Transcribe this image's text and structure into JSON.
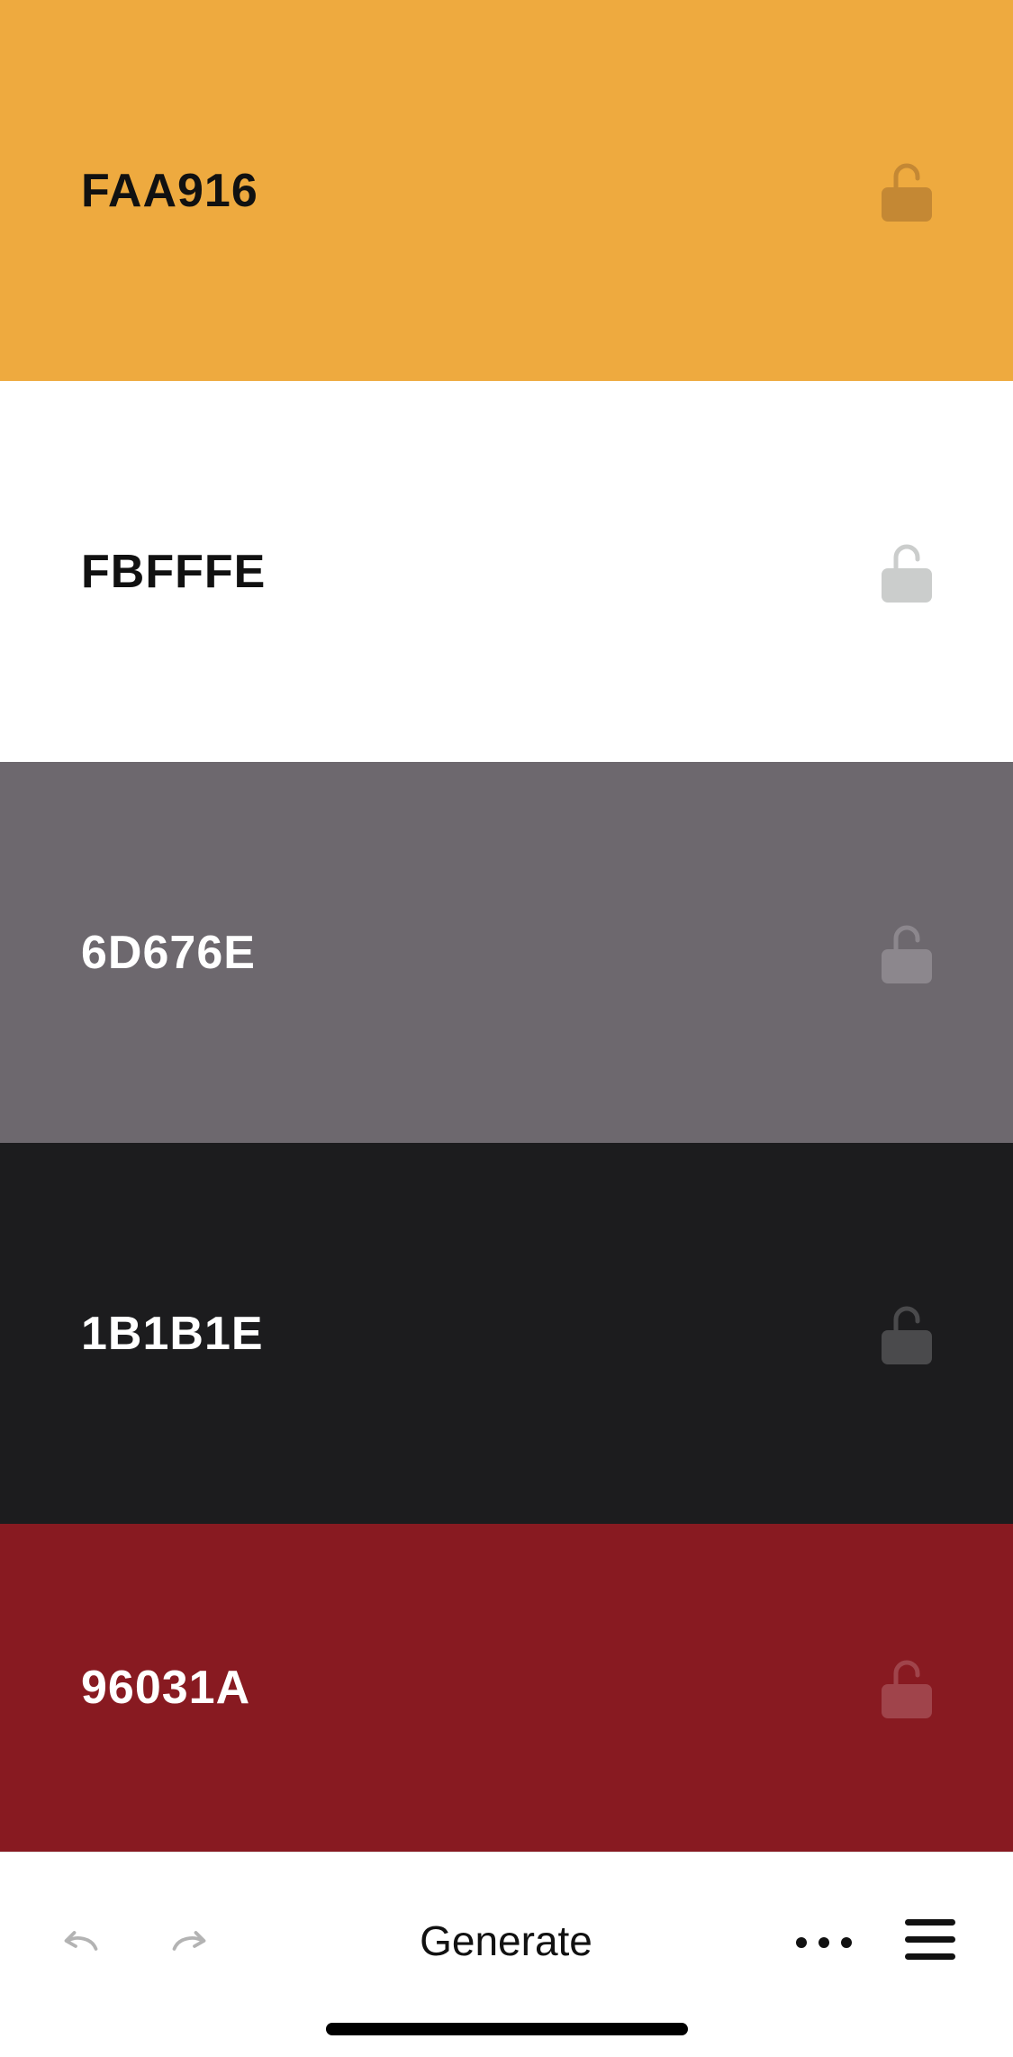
{
  "palette": {
    "swatches": [
      {
        "hex": "FAA916",
        "background": "#EEAA3F",
        "text_color": "#111111",
        "lock_color": "#C48834",
        "locked": false
      },
      {
        "hex": "FBFFFE",
        "background": "#FFFFFF",
        "text_color": "#111111",
        "lock_color": "#CBCDCC",
        "locked": false
      },
      {
        "hex": "6D676E",
        "background": "#6D686E",
        "text_color": "#FFFFFF",
        "lock_color": "#8C878D",
        "locked": false
      },
      {
        "hex": "1B1B1E",
        "background": "#1C1C1E",
        "text_color": "#FFFFFF",
        "lock_color": "#4A4A4C",
        "locked": false
      },
      {
        "hex": "96031A",
        "background": "#881A21",
        "text_color": "#FFFFFF",
        "lock_color": "#A0444B",
        "locked": false
      }
    ]
  },
  "toolbar": {
    "undo_icon": "undo-arrow-icon",
    "redo_icon": "redo-arrow-icon",
    "generate_label": "Generate",
    "more_icon": "more-dots-icon",
    "menu_icon": "hamburger-menu-icon",
    "disabled_icon_color": "#B3B3B3",
    "active_icon_color": "#111111"
  }
}
